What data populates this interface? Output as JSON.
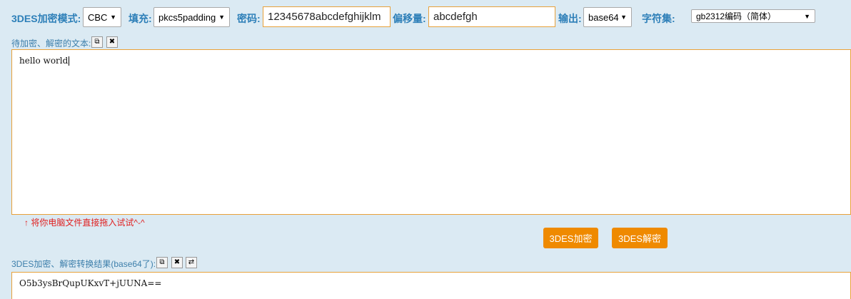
{
  "toolbar": {
    "mode_label": "3DES加密模式:",
    "mode_value": "CBC",
    "padding_label": "填充:",
    "padding_value": "pkcs5padding",
    "key_label": "密码:",
    "key_value": "12345678abcdefghijklm",
    "iv_label": "偏移量:",
    "iv_value": "abcdefgh",
    "output_label": "输出:",
    "output_value": "base64",
    "charset_label": "字符集:",
    "charset_value": "gb2312编码（简体）"
  },
  "input_section": {
    "label": "待加密、解密的文本:",
    "text": "hello world",
    "drag_hint": "↑ 将你电脑文件直接拖入试试^-^"
  },
  "actions": {
    "encrypt_label": "3DES加密",
    "decrypt_label": "3DES解密"
  },
  "result_section": {
    "label": "3DES加密、解密转换结果(base64了):",
    "text": "O5b3ysBrQupUKxvT+jUUNA=="
  },
  "icons": {
    "copy": "copy-icon",
    "clear": "close-icon",
    "swap": "swap-icon"
  },
  "colors": {
    "accent": "#2d7fb8",
    "button": "#ef8a00",
    "border": "#e8a13a",
    "hint": "#e02020",
    "background": "#dbeaf3"
  }
}
